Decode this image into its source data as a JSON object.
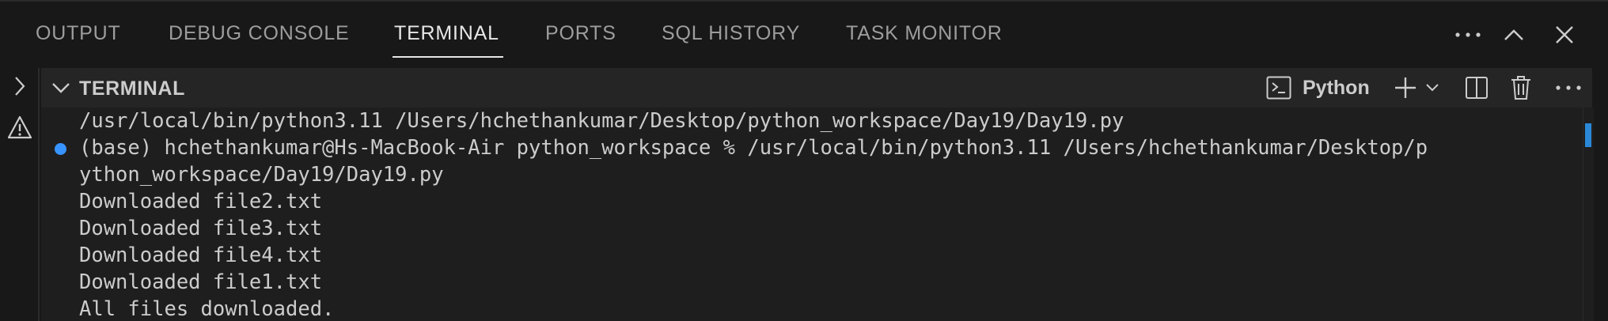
{
  "panel": {
    "tabs": [
      {
        "label": "OUTPUT"
      },
      {
        "label": "DEBUG CONSOLE"
      },
      {
        "label": "TERMINAL"
      },
      {
        "label": "PORTS"
      },
      {
        "label": "SQL HISTORY"
      },
      {
        "label": "TASK MONITOR"
      }
    ],
    "active_tab": "TERMINAL",
    "actions": [
      "more-icon",
      "chevron-up-icon",
      "close-icon"
    ]
  },
  "sidebar": {
    "icons": [
      "chevron-right-icon",
      "warning-icon"
    ]
  },
  "terminal": {
    "section_title": "TERMINAL",
    "profile_name": "Python",
    "header_icons": [
      "terminal-icon",
      "plus-icon",
      "chevron-down-icon",
      "split-icon",
      "trash-icon",
      "more-icon"
    ],
    "lines": [
      "/usr/local/bin/python3.11 /Users/hchethankumar/Desktop/python_workspace/Day19/Day19.py",
      "(base) hchethankumar@Hs-MacBook-Air python_workspace % /usr/local/bin/python3.11 /Users/hchethankumar/Desktop/p",
      "ython_workspace/Day19/Day19.py",
      "Downloaded file2.txt",
      "Downloaded file3.txt",
      "Downloaded file4.txt",
      "Downloaded file1.txt",
      "All files downloaded."
    ],
    "command_dot_color": "#3794ff"
  },
  "colors": {
    "background": "#181818",
    "terminal_bg": "#1e1e1e",
    "header_bg": "#252526",
    "text": "#cccccc",
    "muted": "#9d9d9d",
    "accent": "#2b88d8"
  }
}
